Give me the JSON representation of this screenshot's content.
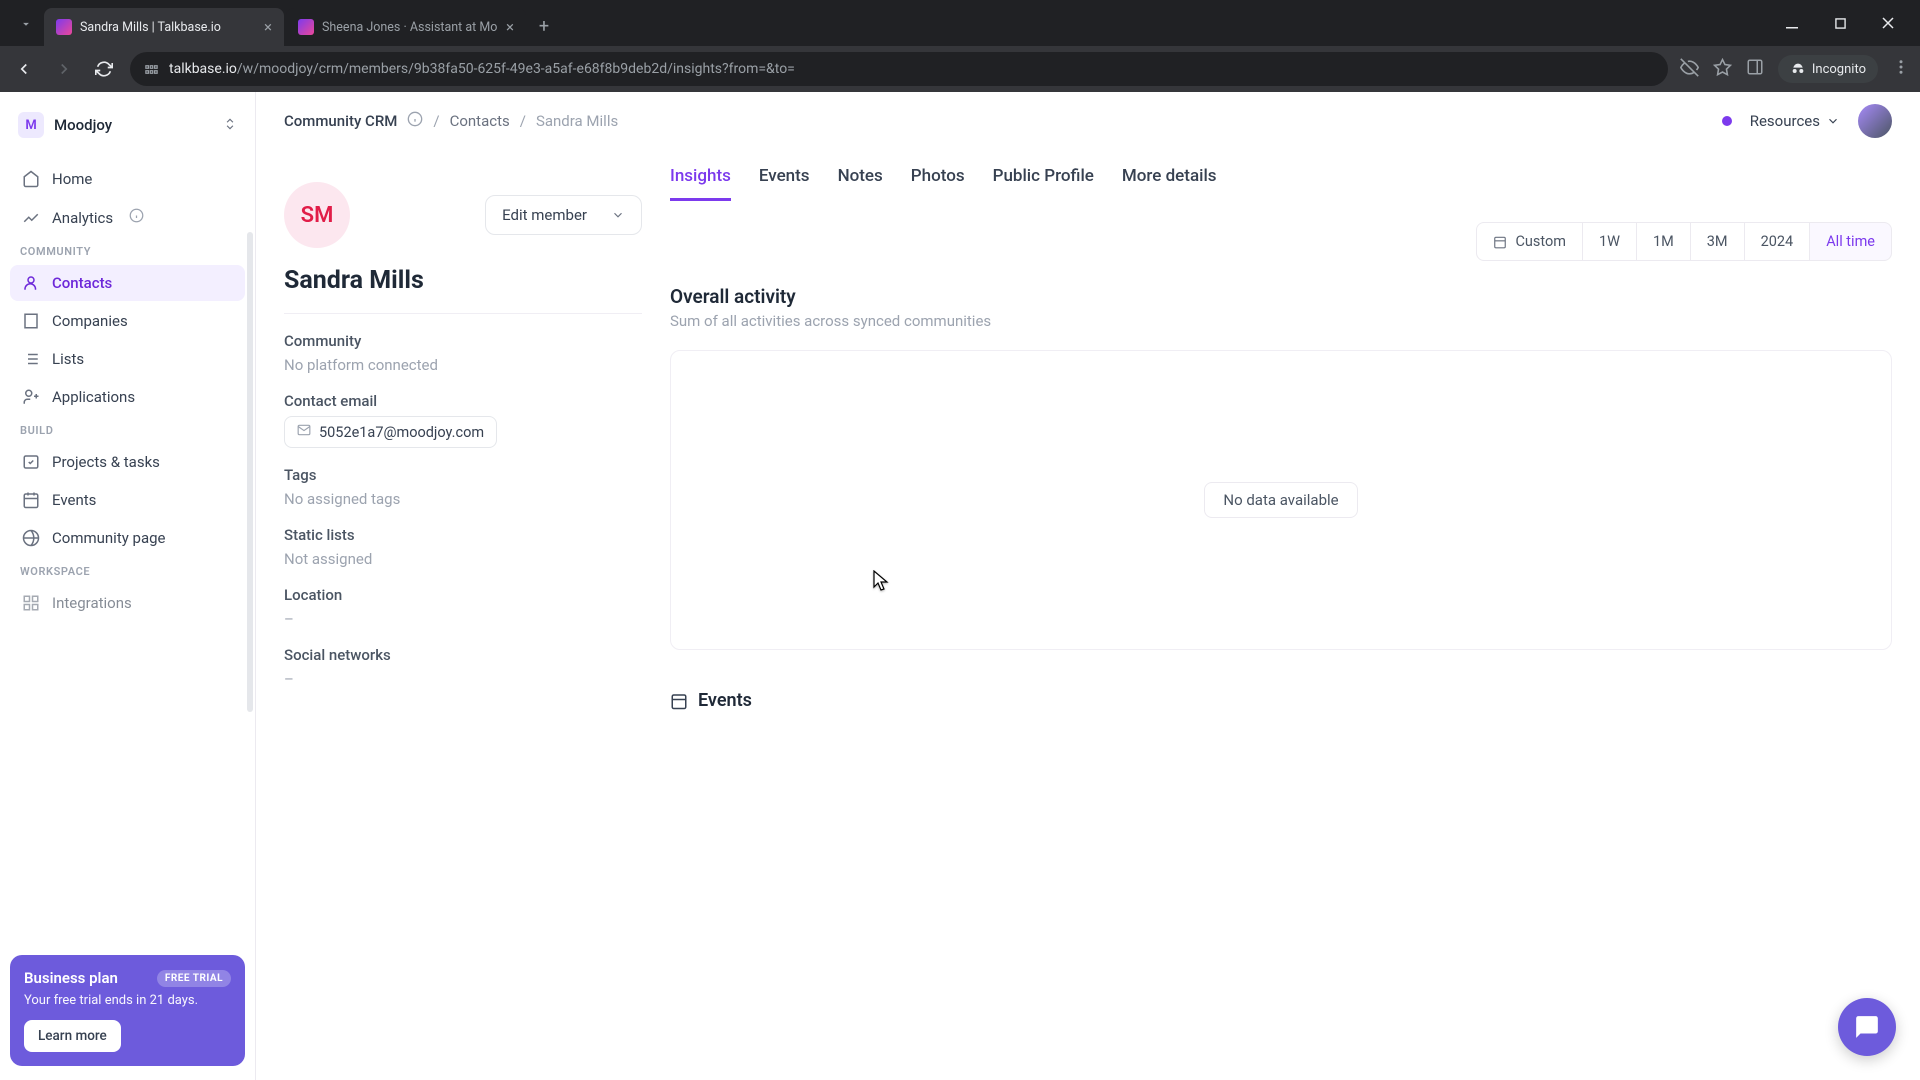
{
  "browser": {
    "tabs": [
      {
        "title": "Sandra Mills | Talkbase.io",
        "active": true
      },
      {
        "title": "Sheena Jones · Assistant at Mo",
        "active": false
      }
    ],
    "url_domain": "talkbase.io",
    "url_path": "/w/moodjoy/crm/members/9b38fa50-625f-49e3-a5af-e68f8b9deb2d/insights?from=&to=",
    "incognito_label": "Incognito"
  },
  "workspace": {
    "avatar_letter": "M",
    "name": "Moodjoy"
  },
  "sidebar": {
    "items_top": [
      {
        "label": "Home",
        "icon": "home"
      },
      {
        "label": "Analytics",
        "icon": "analytics",
        "info": true
      }
    ],
    "section_community": "COMMUNITY",
    "items_community": [
      {
        "label": "Contacts",
        "icon": "contacts",
        "active": true
      },
      {
        "label": "Companies",
        "icon": "companies"
      },
      {
        "label": "Lists",
        "icon": "lists"
      },
      {
        "label": "Applications",
        "icon": "applications"
      }
    ],
    "section_build": "BUILD",
    "items_build": [
      {
        "label": "Projects & tasks",
        "icon": "projects"
      },
      {
        "label": "Events",
        "icon": "events"
      },
      {
        "label": "Community page",
        "icon": "globe"
      }
    ],
    "section_workspace": "WORKSPACE",
    "items_workspace": [
      {
        "label": "Integrations",
        "icon": "integrations"
      }
    ]
  },
  "trial": {
    "title": "Business plan",
    "badge": "FREE TRIAL",
    "subtitle": "Your free trial ends in 21 days.",
    "button": "Learn more"
  },
  "breadcrumb": {
    "root": "Community CRM",
    "mid": "Contacts",
    "current": "Sandra Mills"
  },
  "topbar": {
    "resources_label": "Resources"
  },
  "member": {
    "initials": "SM",
    "edit_label": "Edit member",
    "name": "Sandra Mills",
    "fields": {
      "community_label": "Community",
      "community_value": "No platform connected",
      "email_label": "Contact email",
      "email_value": "5052e1a7@moodjoy.com",
      "tags_label": "Tags",
      "tags_value": "No assigned tags",
      "lists_label": "Static lists",
      "lists_value": "Not assigned",
      "location_label": "Location",
      "location_value": "–",
      "social_label": "Social networks",
      "social_value": "–"
    }
  },
  "tabs": {
    "insights": "Insights",
    "events": "Events",
    "notes": "Notes",
    "photos": "Photos",
    "public_profile": "Public Profile",
    "more_details": "More details"
  },
  "range": {
    "custom": "Custom",
    "w1": "1W",
    "m1": "1M",
    "m3": "3M",
    "y": "2024",
    "all": "All time"
  },
  "activity": {
    "title": "Overall activity",
    "subtitle": "Sum of all activities across synced communities",
    "no_data": "No data available"
  },
  "events_section": {
    "title": "Events"
  }
}
